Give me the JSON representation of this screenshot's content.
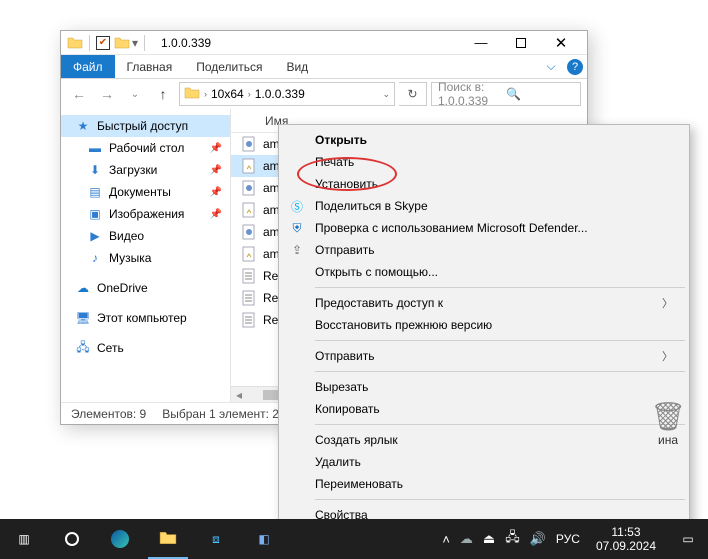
{
  "window": {
    "title": "1.0.0.339",
    "tabs": {
      "file": "Файл",
      "home": "Главная",
      "share": "Поделиться",
      "view": "Вид"
    },
    "breadcrumb": [
      "10x64",
      "1.0.0.339"
    ],
    "search_placeholder": "Поиск в: 1.0.0.339"
  },
  "sidebar": {
    "quick": "Быстрый доступ",
    "desktop": "Рабочий стол",
    "downloads": "Загрузки",
    "documents": "Документы",
    "pictures": "Изображения",
    "videos": "Видео",
    "music": "Музыка",
    "onedrive": "OneDrive",
    "thispc": "Этот компьютер",
    "network": "Сеть"
  },
  "list": {
    "header_name": "Имя",
    "items": [
      {
        "name": "amd",
        "type": "cat"
      },
      {
        "name": "amd",
        "type": "inf",
        "selected": true
      },
      {
        "name": "amd",
        "type": "cat"
      },
      {
        "name": "amd",
        "type": "inf"
      },
      {
        "name": "amd",
        "type": "cat"
      },
      {
        "name": "amd",
        "type": "inf"
      },
      {
        "name": "Rea",
        "type": "txt"
      },
      {
        "name": "Rea",
        "type": "txt"
      },
      {
        "name": "Rele",
        "type": "txt"
      }
    ]
  },
  "status": {
    "count_label": "Элементов: 9",
    "selection_label": "Выбран 1 элемент: 2"
  },
  "ctx": {
    "open": "Открыть",
    "print": "Печать",
    "install": "Установить",
    "skype": "Поделиться в Skype",
    "defender": "Проверка с использованием Microsoft Defender...",
    "share": "Отправить",
    "openwith": "Открыть с помощью...",
    "giveaccess": "Предоставить доступ к",
    "restore": "Восстановить прежнюю версию",
    "sendto": "Отправить",
    "cut": "Вырезать",
    "copy": "Копировать",
    "shortcut": "Создать ярлык",
    "delete": "Удалить",
    "rename": "Переименовать",
    "properties": "Свойства"
  },
  "desktop": {
    "recycle_suffix": "ина"
  },
  "taskbar": {
    "lang": "РУС",
    "time": "11:53",
    "date": "07.09.2024"
  }
}
